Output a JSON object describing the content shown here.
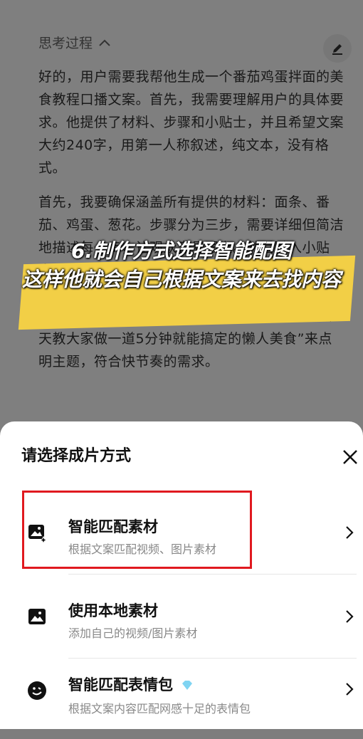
{
  "thinking": {
    "header": "思考过程",
    "paragraph1": "好的，用户需要我帮他生成一个番茄鸡蛋拌面的美食教程口播文案。首先，我需要理解用户的具体要求。他提供了材料、步骤和小贴士，并且希望文案大约240字，用第一人称叙述，纯文本，没有格式。",
    "paragraph2": "首先，我要确保涵盖所有提供的材料：面条、番茄、鸡蛋、葱花。步骤分为三步，需要详细但简洁地描述每一步，让观众容易跟上。然后融入小贴士，让内容更有实用性。考虑到这是美食教程，风格应该不同。需要口语化，亲切，让观众感觉像是在跟着朋友一起做菜。开头要吸引人，可能用“今天教大家做一道5分钟就能搞定的懒人美食”来点明主题，符合快节奏的需求。"
  },
  "overlay": {
    "line1": "6.制作方式选择智能配图",
    "line2": "这样他就会自己根据文案来去找内容"
  },
  "sheet": {
    "title": "请选择成片方式",
    "options": [
      {
        "label": "智能匹配素材",
        "sub": "根据文案匹配视频、图片素材",
        "icon": "image-sparkle-icon"
      },
      {
        "label": "使用本地素材",
        "sub": "添加自己的视频/图片素材",
        "icon": "image-icon"
      },
      {
        "label": "智能匹配表情包",
        "sub": "根据文案内容匹配网感十足的表情包",
        "icon": "smiley-icon"
      }
    ]
  },
  "colors": {
    "highlight": "#f2cf46",
    "red_box": "#e0191f"
  }
}
